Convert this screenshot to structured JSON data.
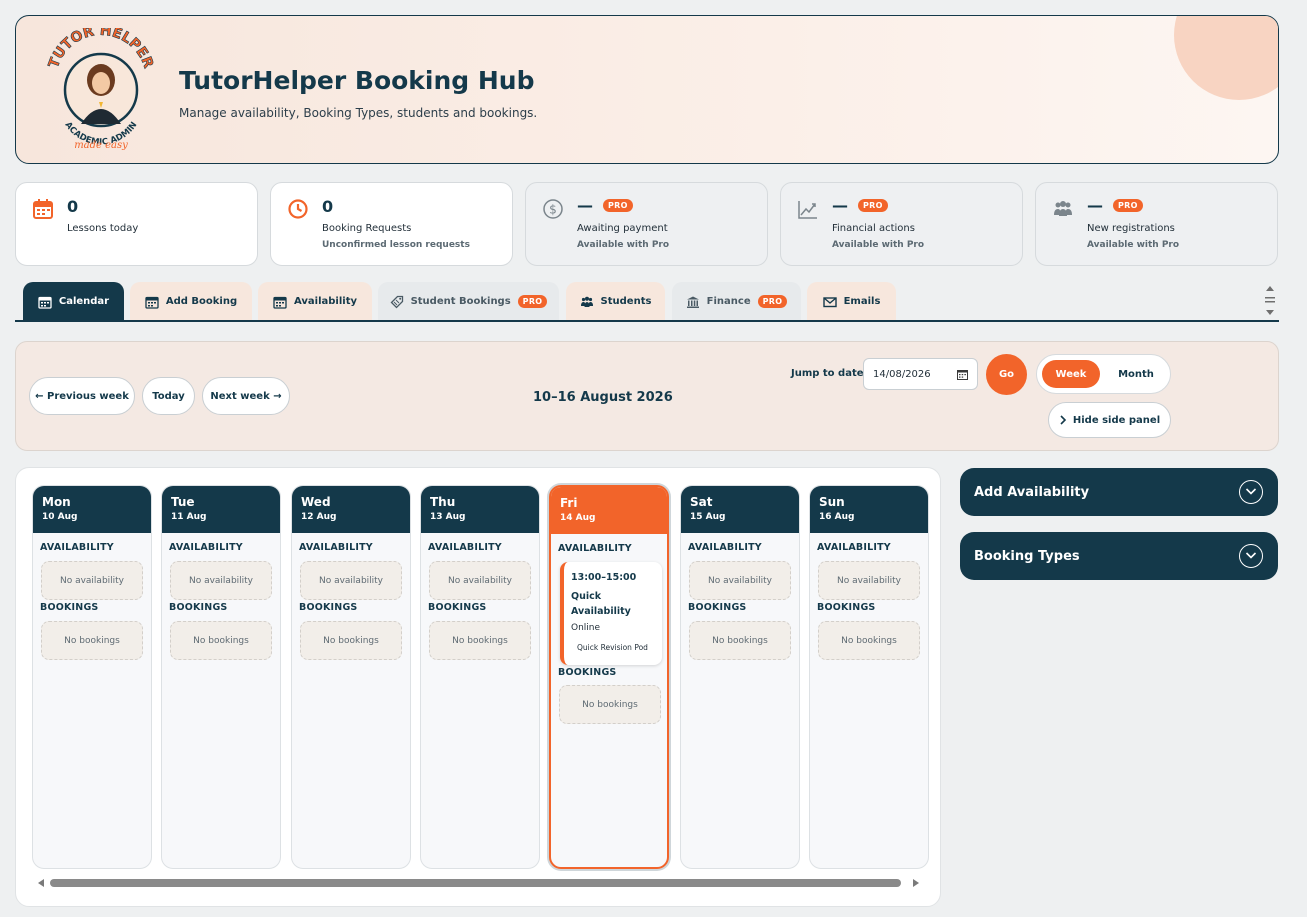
{
  "header": {
    "title": "TutorHelper Booking Hub",
    "subtitle": "Manage availability, Booking Types, students and bookings.",
    "logo_top": "TUTOR HELPER",
    "logo_bottom": "ACADEMIC ADMIN",
    "logo_tagline": "made easy"
  },
  "stats": [
    {
      "icon": "calendar-icon",
      "value": "0",
      "label": "Lessons today",
      "sub": "",
      "pro": false
    },
    {
      "icon": "clock-icon",
      "value": "0",
      "label": "Booking Requests",
      "sub": "Unconfirmed lesson requests",
      "pro": false
    },
    {
      "icon": "dollar-icon",
      "value": "—",
      "label": "Awaiting payment",
      "sub": "Available with Pro",
      "pro": true
    },
    {
      "icon": "chart-icon",
      "value": "—",
      "label": "Financial actions",
      "sub": "Available with Pro",
      "pro": true
    },
    {
      "icon": "users-icon",
      "value": "—",
      "label": "New registrations",
      "sub": "Available with Pro",
      "pro": true
    }
  ],
  "pro_label": "PRO",
  "tabs": [
    {
      "label": "Calendar",
      "icon": "calendar-icon",
      "active": true,
      "pro": false
    },
    {
      "label": "Add Booking",
      "icon": "calendar-icon",
      "active": false,
      "pro": false
    },
    {
      "label": "Availability",
      "icon": "calendar-icon",
      "active": false,
      "pro": false
    },
    {
      "label": "Student Bookings",
      "icon": "tag-icon",
      "active": false,
      "pro": true
    },
    {
      "label": "Students",
      "icon": "users-icon",
      "active": false,
      "pro": false
    },
    {
      "label": "Finance",
      "icon": "bank-icon",
      "active": false,
      "pro": true
    },
    {
      "label": "Emails",
      "icon": "mail-icon",
      "active": false,
      "pro": false
    }
  ],
  "toolbar": {
    "prev_label": "← Previous week",
    "today_label": "Today",
    "next_label": "Next week →",
    "range_title": "10–16 August 2026",
    "jump_label": "Jump to date",
    "date_value": "14/08/2026",
    "go_label": "Go",
    "view_week": "Week",
    "view_month": "Month",
    "hide_panel_label": "Hide side panel"
  },
  "calendar": {
    "availability_label": "AVAILABILITY",
    "bookings_label": "BOOKINGS",
    "no_availability": "No availability",
    "no_bookings": "No bookings",
    "days": [
      {
        "name": "Mon",
        "date": "10 Aug",
        "today": false
      },
      {
        "name": "Tue",
        "date": "11 Aug",
        "today": false
      },
      {
        "name": "Wed",
        "date": "12 Aug",
        "today": false
      },
      {
        "name": "Thu",
        "date": "13 Aug",
        "today": false
      },
      {
        "name": "Fri",
        "date": "14 Aug",
        "today": true
      },
      {
        "name": "Sat",
        "date": "15 Aug",
        "today": false
      },
      {
        "name": "Sun",
        "date": "16 Aug",
        "today": false
      }
    ],
    "slot": {
      "time": "13:00–15:00",
      "title": "Quick Availability",
      "mode": "Online",
      "type": "Quick Revision Pod"
    }
  },
  "side_panels": [
    {
      "label": "Add Availability"
    },
    {
      "label": "Booking Types"
    }
  ],
  "colors": {
    "navy": "#14394a",
    "accent": "#f2642a",
    "hero_bg": "#f7e6dc"
  }
}
